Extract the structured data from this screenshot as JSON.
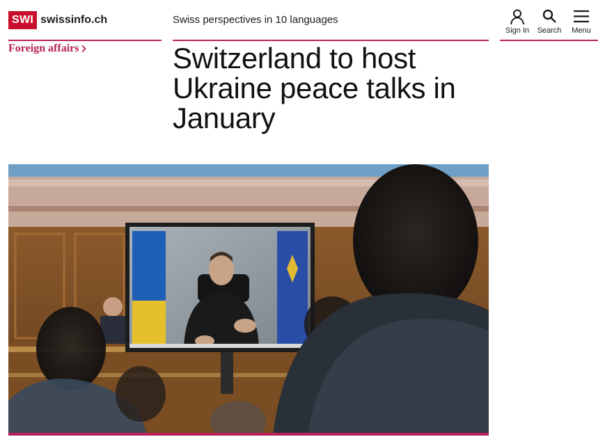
{
  "site": {
    "logo_badge": "SWI",
    "logo_name": "swissinfo.ch",
    "tagline": "Swiss perspectives in 10 languages"
  },
  "header_tools": {
    "sign_in": "Sign In",
    "search": "Search",
    "menu": "Menu"
  },
  "article": {
    "category": "Foreign affairs",
    "headline": "Switzerland to host Ukraine peace talks in January",
    "photo_icon": "video-conference-photo"
  },
  "colors": {
    "brand_red": "#c8102e",
    "accent": "#b8215a"
  }
}
